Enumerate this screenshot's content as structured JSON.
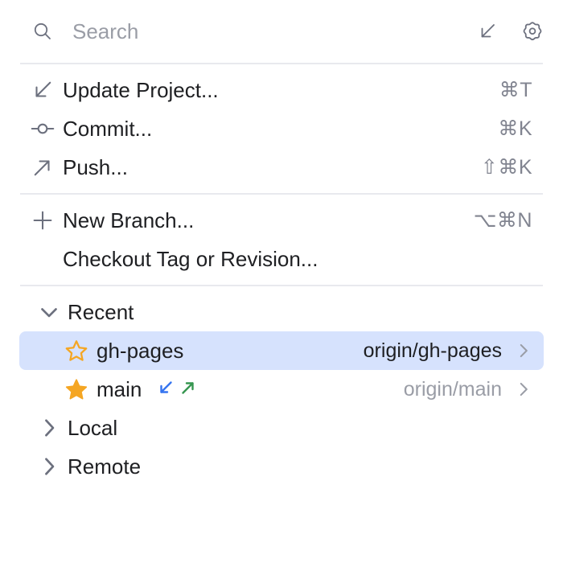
{
  "search": {
    "placeholder": "Search",
    "value": "",
    "icon": "search-icon"
  },
  "header_actions": [
    {
      "name": "update-project-icon",
      "title": "Update Project"
    },
    {
      "name": "gear-icon",
      "title": "Settings"
    }
  ],
  "actions": [
    {
      "icon": "arrow-down-left-icon",
      "label": "Update Project...",
      "shortcut": "⌘T"
    },
    {
      "icon": "commit-node-icon",
      "label": "Commit...",
      "shortcut": "⌘K"
    },
    {
      "icon": "arrow-up-right-icon",
      "label": "Push...",
      "shortcut": "⇧⌘K"
    }
  ],
  "branch_actions": [
    {
      "icon": "plus-icon",
      "label": "New Branch...",
      "shortcut": "⌥⌘N"
    },
    {
      "icon": "none",
      "label": "Checkout Tag or Revision...",
      "shortcut": ""
    }
  ],
  "groups": [
    {
      "label": "Recent",
      "expanded": true,
      "chevron": "chevron-down-icon",
      "branches": [
        {
          "name": "gh-pages",
          "favorite": false,
          "star": "star-outline-icon",
          "tracking": "origin/gh-pages",
          "selected": true,
          "incoming": false,
          "outgoing": false,
          "chevron": "chevron-right-icon"
        },
        {
          "name": "main",
          "favorite": true,
          "star": "star-filled-icon",
          "tracking": "origin/main",
          "selected": false,
          "incoming": true,
          "outgoing": true,
          "chevron": "chevron-right-icon"
        }
      ]
    },
    {
      "label": "Local",
      "expanded": false,
      "chevron": "chevron-right-icon",
      "branches": []
    },
    {
      "label": "Remote",
      "expanded": false,
      "chevron": "chevron-right-icon",
      "branches": []
    }
  ],
  "colors": {
    "selection": "#d6e2fd",
    "star": "#f5a623",
    "incoming": "#3574f0",
    "outgoing": "#369650",
    "separator": "#e8e9ee",
    "text": "#1e1f22",
    "muted": "#9a9da6",
    "icon": "#6c707e"
  }
}
